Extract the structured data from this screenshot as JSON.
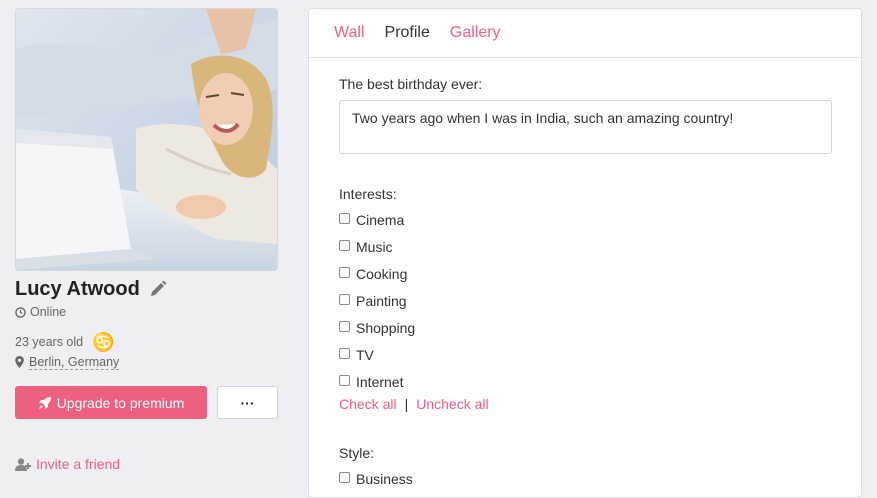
{
  "profile": {
    "name": "Lucy Atwood",
    "status": "Online",
    "age": "23 years old",
    "zodiac_symbol": "♋",
    "location": "Berlin, Germany",
    "upgrade_label": "Upgrade to premium",
    "more_label": "···",
    "invite_label": "Invite a friend"
  },
  "tabs": [
    {
      "label": "Wall"
    },
    {
      "label": "Profile"
    },
    {
      "label": "Gallery"
    }
  ],
  "question": {
    "label": "The best birthday ever:",
    "answer": "Two years ago when I was in India, such an amazing country!"
  },
  "interests": {
    "label": "Interests:",
    "items": [
      "Cinema",
      "Music",
      "Cooking",
      "Painting",
      "Shopping",
      "TV",
      "Internet"
    ],
    "check_all": "Check all",
    "separator": "|",
    "uncheck_all": "Uncheck all"
  },
  "style": {
    "label": "Style:",
    "items": [
      "Business"
    ]
  },
  "colors": {
    "accent": "#ef5f7e",
    "background": "#efeef4",
    "zodiac": "#2f7d8f"
  }
}
